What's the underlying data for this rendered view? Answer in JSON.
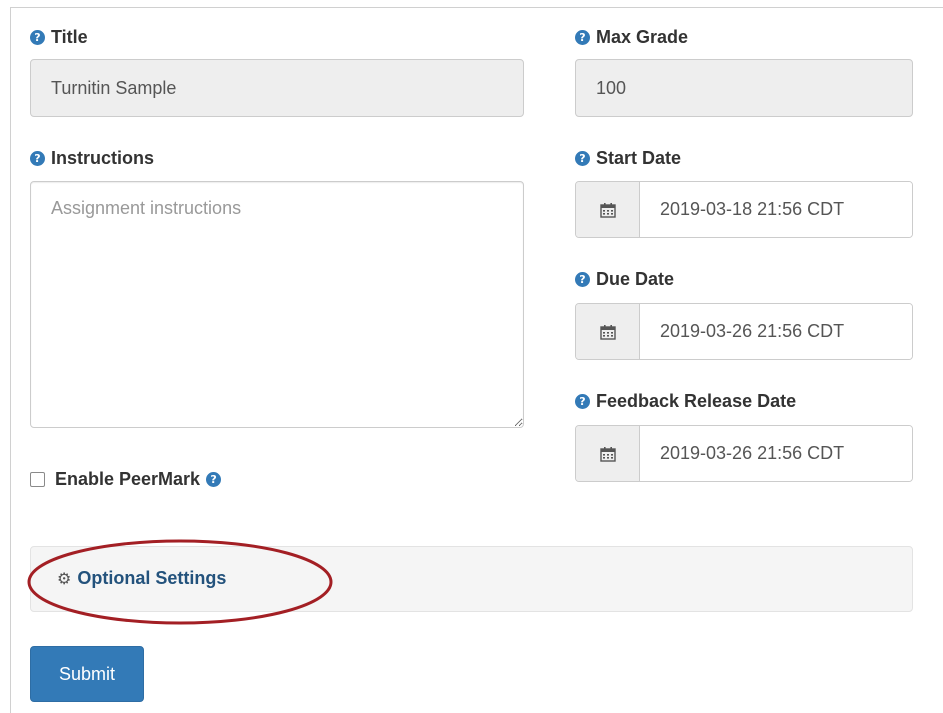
{
  "form": {
    "title": {
      "label": "Title",
      "value": "Turnitin Sample"
    },
    "max_grade": {
      "label": "Max Grade",
      "value": "100"
    },
    "instructions": {
      "label": "Instructions",
      "placeholder": "Assignment instructions"
    },
    "start_date": {
      "label": "Start Date",
      "value": "2019-03-18 21:56 CDT"
    },
    "due_date": {
      "label": "Due Date",
      "value": "2019-03-26 21:56 CDT"
    },
    "feedback_release_date": {
      "label": "Feedback Release Date",
      "value": "2019-03-26 21:56 CDT"
    },
    "peermark": {
      "label": "Enable PeerMark",
      "checked": false
    },
    "optional_settings": {
      "label": "Optional Settings"
    },
    "submit_label": "Submit"
  },
  "colors": {
    "primary": "#337ab7",
    "link": "#23527c",
    "annotation": "#a31f24"
  },
  "icons": {
    "help": "question-circle-icon",
    "calendar": "calendar-icon",
    "gear": "gear-icon"
  }
}
